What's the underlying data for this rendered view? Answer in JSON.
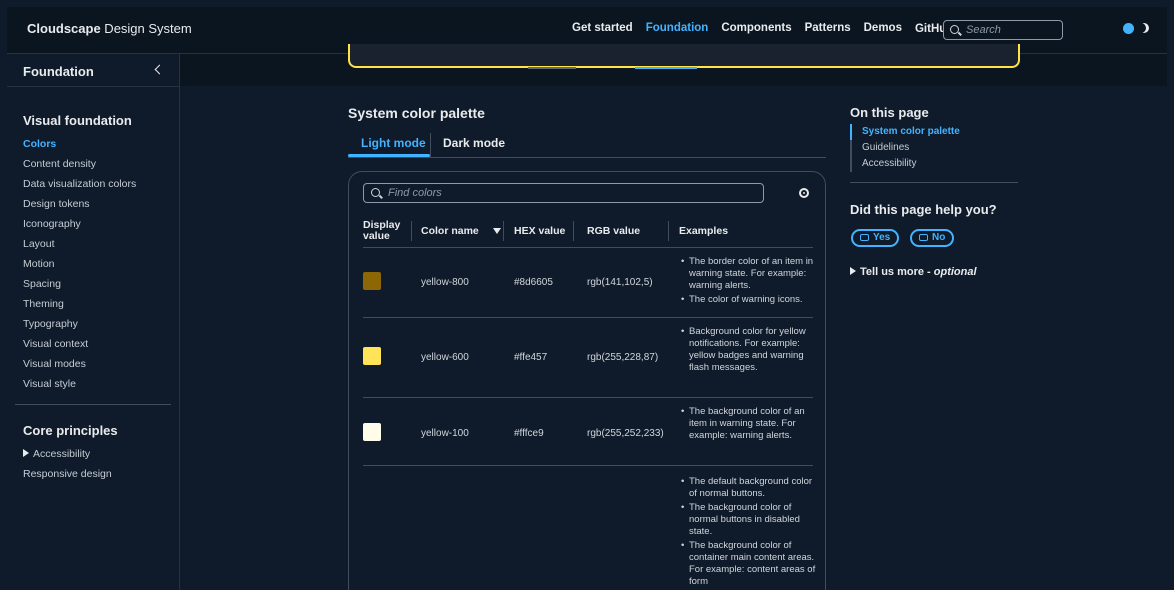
{
  "topnav": {
    "brand_bold": "Cloudscape",
    "brand_rest": " Design System",
    "links": [
      "Get started",
      "Foundation",
      "Components",
      "Patterns",
      "Demos",
      "GitHub"
    ],
    "active_link": "Foundation",
    "search_placeholder": "Search",
    "accent": "#42b4ff"
  },
  "sidebar": {
    "header": "Foundation",
    "sections": [
      {
        "title": "Visual foundation",
        "items": [
          "Colors",
          "Content density",
          "Data visualization colors",
          "Design tokens",
          "Iconography",
          "Layout",
          "Motion",
          "Spacing",
          "Theming",
          "Typography",
          "Visual context",
          "Visual modes",
          "Visual style"
        ],
        "active": "Colors"
      },
      {
        "title": "Core principles",
        "items": [
          "Accessibility",
          "Responsive design"
        ]
      }
    ]
  },
  "main": {
    "title": "System color palette",
    "tabs": [
      "Light mode",
      "Dark mode"
    ],
    "active_tab": "Light mode",
    "search_placeholder": "Find colors",
    "columns": [
      "Display value",
      "Color name",
      "HEX value",
      "RGB value",
      "Examples"
    ],
    "rows": [
      {
        "swatch": "#8d6605",
        "name": "yellow-800",
        "hex": "#8d6605",
        "rgb": "rgb(141,102,5)",
        "examples": [
          "The border color of an item in warning state. For example: warning alerts.",
          "The color of warning icons."
        ]
      },
      {
        "swatch": "#ffe457",
        "name": "yellow-600",
        "hex": "#ffe457",
        "rgb": "rgb(255,228,87)",
        "examples": [
          "Background color for yellow notifications. For example: yellow badges and warning flash messages."
        ]
      },
      {
        "swatch": "#fffce9",
        "name": "yellow-100",
        "hex": "#fffce9",
        "rgb": "rgb(255,252,233)",
        "examples": [
          "The background color of an item in warning state. For example: warning alerts."
        ]
      },
      {
        "swatch": "",
        "name": "",
        "hex": "",
        "rgb": "",
        "examples": [
          "The default background color of normal buttons.",
          "The background color of normal buttons in disabled state.",
          "The background color of container main content areas. For example: content areas of form"
        ]
      }
    ]
  },
  "right_panel": {
    "on_this_page": "On this page",
    "anchors": [
      "System color palette",
      "Guidelines",
      "Accessibility"
    ],
    "active_anchor": "System color palette",
    "help_title": "Did this page help you?",
    "yes": "Yes",
    "no": "No",
    "tell_more": "Tell us more - ",
    "optional": "optional"
  }
}
